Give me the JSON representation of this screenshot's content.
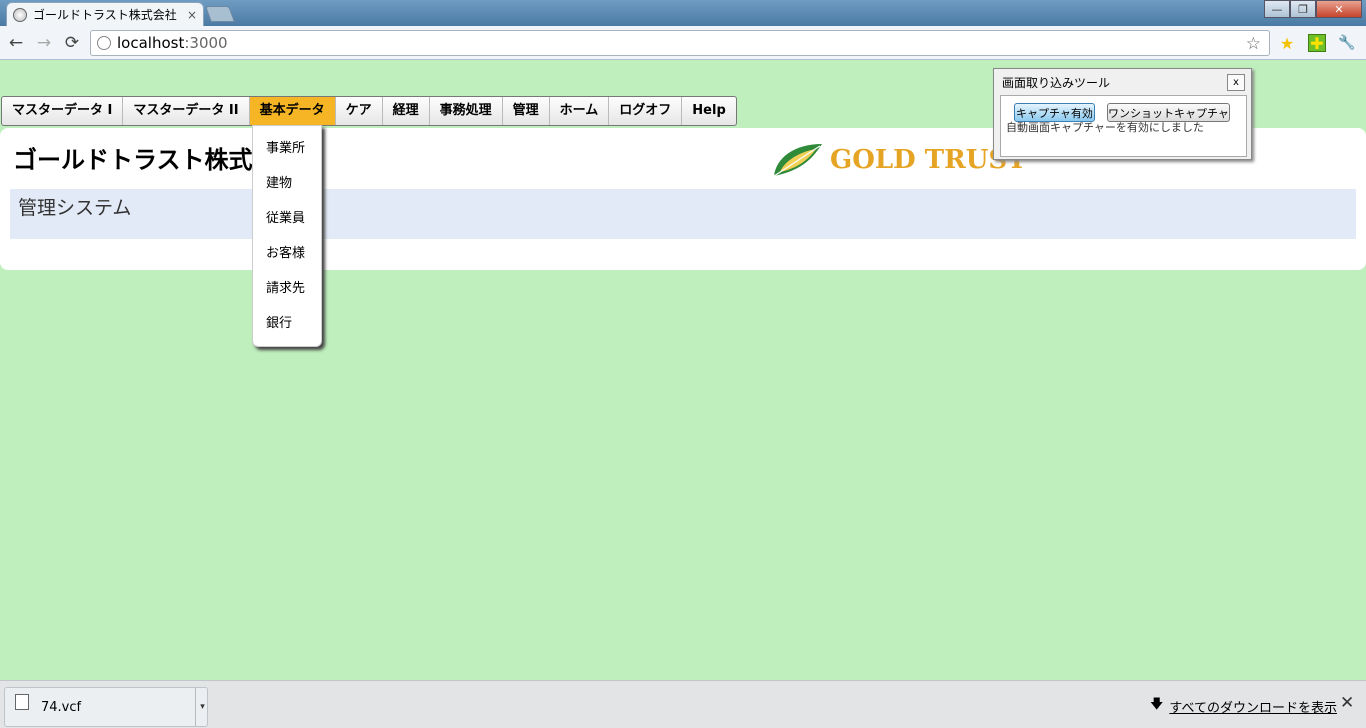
{
  "browser": {
    "tab_title": "ゴールドトラスト株式会社",
    "tab_close": "×",
    "url_host": "localhost",
    "url_port": ":3000",
    "back": "←",
    "forward": "→",
    "reload": "⟳",
    "bookmark_star": "☆",
    "ext_star": "★",
    "ext_puzzle": "✚",
    "wrench": "🔧",
    "win_minimize": "—",
    "win_restore": "❐",
    "win_close": "✕"
  },
  "menu": {
    "items": [
      "マスターデータ I",
      "マスターデータ II",
      "基本データ",
      "ケア",
      "経理",
      "事務処理",
      "管理",
      "ホーム",
      "ログオフ",
      "Help"
    ]
  },
  "dropdown": {
    "items": [
      "事業所",
      "建物",
      "従業員",
      "お客様",
      "請求先",
      "銀行"
    ]
  },
  "header": {
    "company_name": "ゴールドトラスト株式会社",
    "logo_text": "GOLD TRUST",
    "subtitle": "管理システム"
  },
  "capture_tool": {
    "title": "画面取り込みツール",
    "close": "x",
    "enable_button": "キャプチャ有効",
    "oneshot_button": "ワンショットキャプチャ",
    "status": "自動画面キャプチャーを有効にしました"
  },
  "downloads": {
    "file_name": "74.vcf",
    "menu_arrow": "▾",
    "show_all": "すべてのダウンロードを表示",
    "download_icon": "🡇",
    "close": "✕"
  },
  "colors": {
    "page_bg": "#bfefbc",
    "menu_active": "#f6b524",
    "logo_gold": "#e6a425",
    "subbar_bg": "#e3eaf7"
  }
}
